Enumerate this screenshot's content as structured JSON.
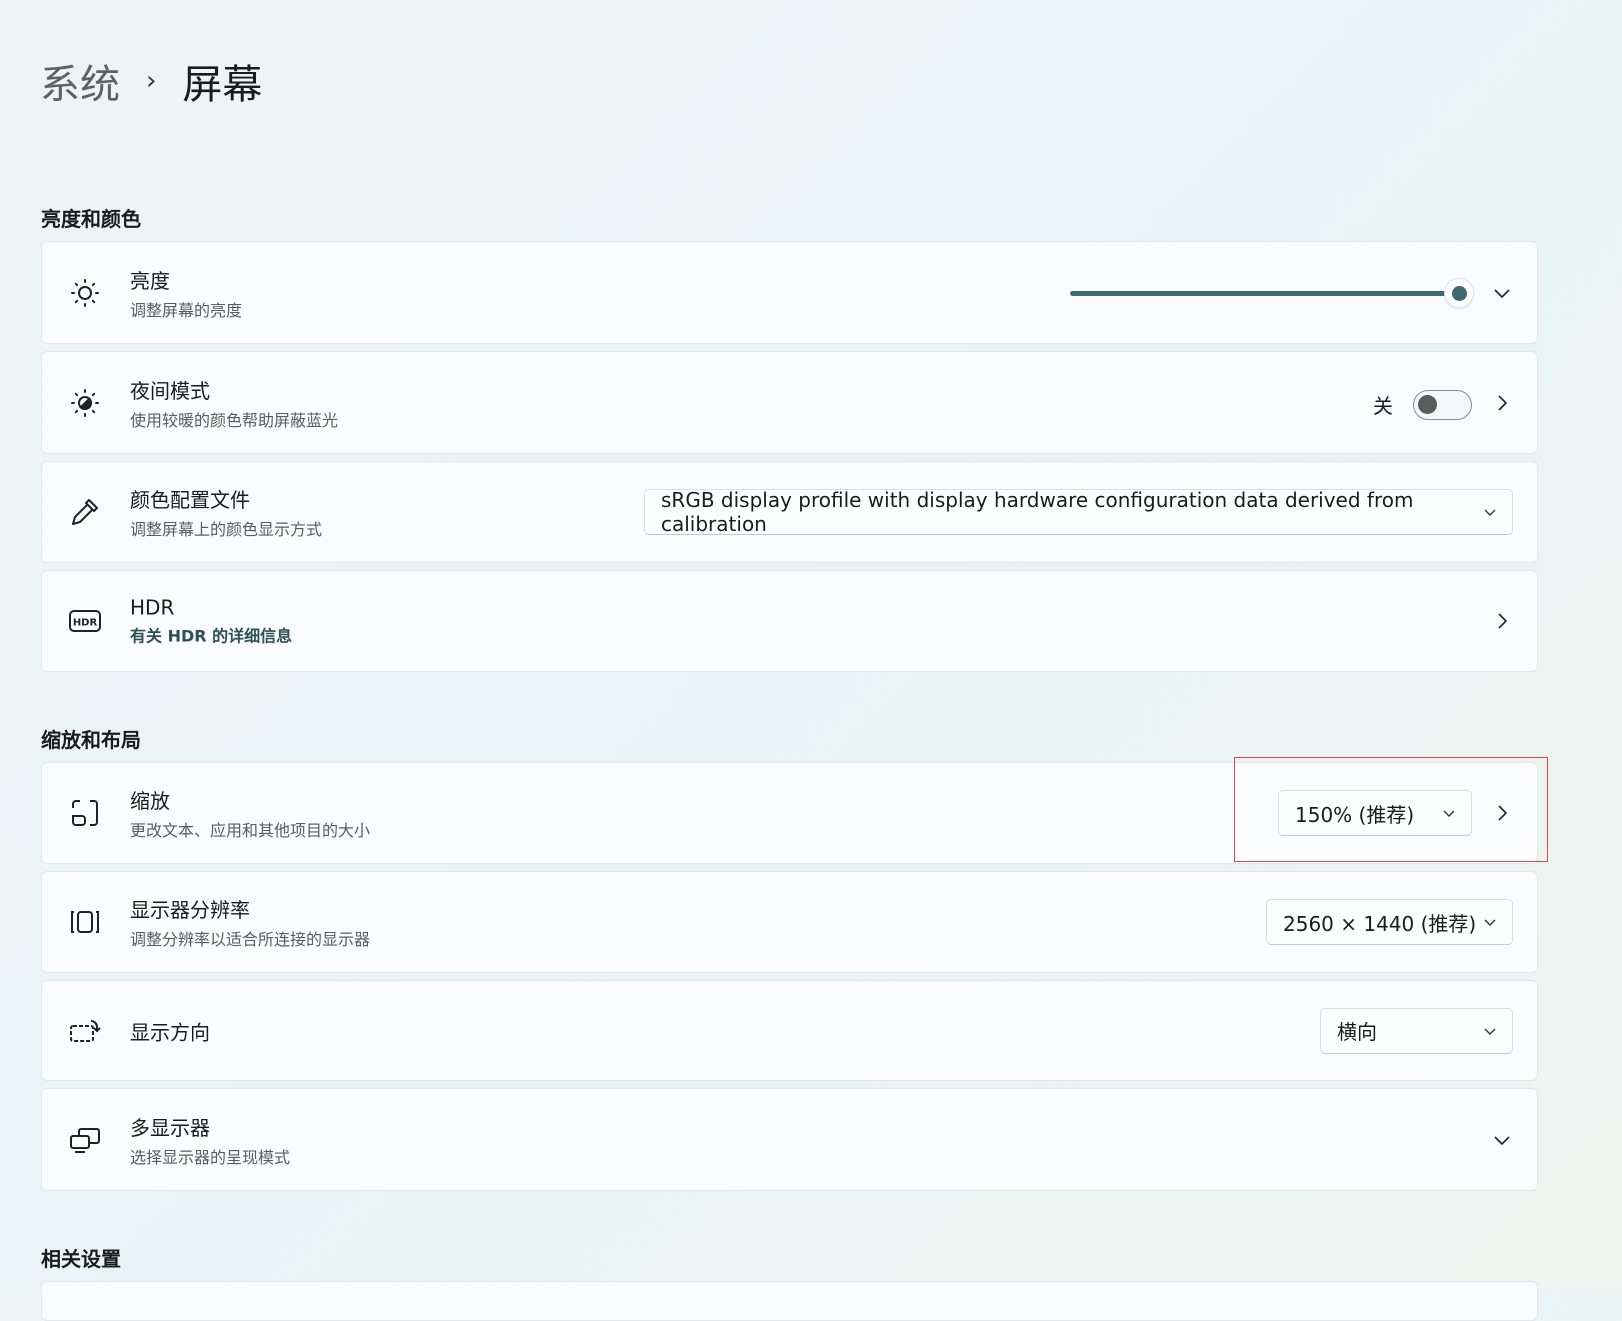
{
  "breadcrumb": {
    "parent": "系统",
    "separator": "›",
    "current": "屏幕"
  },
  "sections": {
    "brightness_color": "亮度和颜色",
    "scale_layout": "缩放和布局",
    "related": "相关设置"
  },
  "brightness": {
    "title": "亮度",
    "subtitle": "调整屏幕的亮度",
    "value_percent": 100,
    "accent": "#3f6770"
  },
  "night_light": {
    "title": "夜间模式",
    "subtitle": "使用较暖的颜色帮助屏蔽蓝光",
    "state_label": "关",
    "on": false
  },
  "color_profile": {
    "title": "颜色配置文件",
    "subtitle": "调整屏幕上的颜色显示方式",
    "selected": "sRGB display profile with display hardware configuration data derived from calibration"
  },
  "hdr": {
    "title": "HDR",
    "subtitle": "有关 HDR 的详细信息"
  },
  "scale": {
    "title": "缩放",
    "subtitle": "更改文本、应用和其他项目的大小",
    "selected": "150% (推荐)"
  },
  "resolution": {
    "title": "显示器分辨率",
    "subtitle": "调整分辨率以适合所连接的显示器",
    "selected": "2560 × 1440 (推荐)"
  },
  "orientation": {
    "title": "显示方向",
    "selected": "横向"
  },
  "multi_display": {
    "title": "多显示器",
    "subtitle": "选择显示器的呈现模式"
  },
  "highlight_color": "#e8474a"
}
